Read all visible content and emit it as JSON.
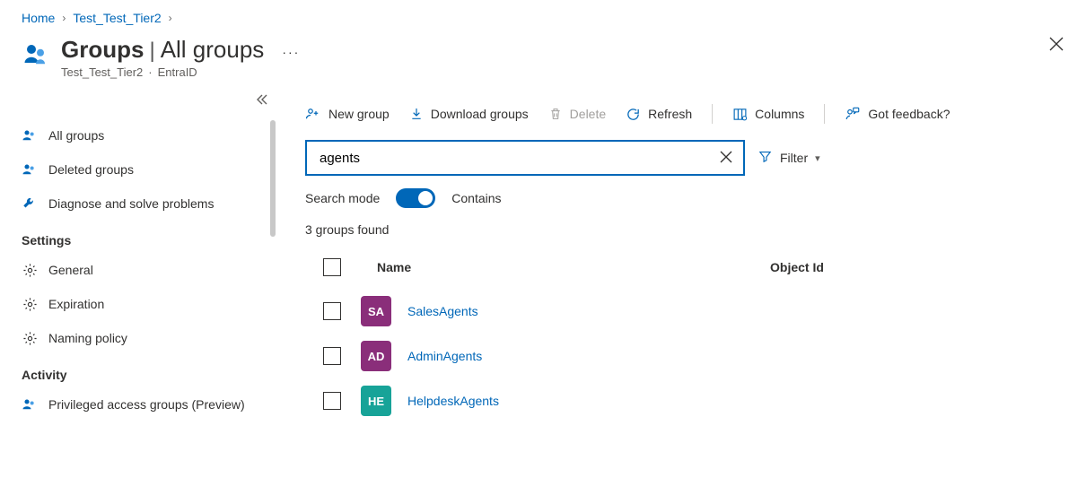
{
  "breadcrumb": {
    "home": "Home",
    "tier": "Test_Test_Tier2"
  },
  "header": {
    "title": "Groups",
    "view": "All groups",
    "subtitle": "Test_Test_Tier2",
    "product": "EntraID",
    "more": "···"
  },
  "sidebar": {
    "items": [
      {
        "label": "All groups",
        "icon": "people"
      },
      {
        "label": "Deleted groups",
        "icon": "people"
      },
      {
        "label": "Diagnose and solve problems",
        "icon": "wrench"
      }
    ],
    "settings_header": "Settings",
    "settings": [
      {
        "label": "General",
        "icon": "gear"
      },
      {
        "label": "Expiration",
        "icon": "gear"
      },
      {
        "label": "Naming policy",
        "icon": "gear"
      }
    ],
    "activity_header": "Activity",
    "activity": [
      {
        "label": "Privileged access groups (Preview)",
        "icon": "people"
      }
    ]
  },
  "toolbar": {
    "new_group": "New group",
    "download": "Download groups",
    "delete": "Delete",
    "refresh": "Refresh",
    "columns": "Columns",
    "feedback": "Got feedback?"
  },
  "search": {
    "value": "agents",
    "filter_label": "Filter",
    "mode_label": "Search mode",
    "mode_value": "Contains"
  },
  "results": {
    "count_text": "3 groups found",
    "columns": {
      "name": "Name",
      "object_id": "Object Id"
    },
    "rows": [
      {
        "initials": "SA",
        "name": "SalesAgents",
        "color": "#8a2e7a"
      },
      {
        "initials": "AD",
        "name": "AdminAgents",
        "color": "#8a2e7a"
      },
      {
        "initials": "HE",
        "name": "HelpdeskAgents",
        "color": "#17a398"
      }
    ]
  }
}
